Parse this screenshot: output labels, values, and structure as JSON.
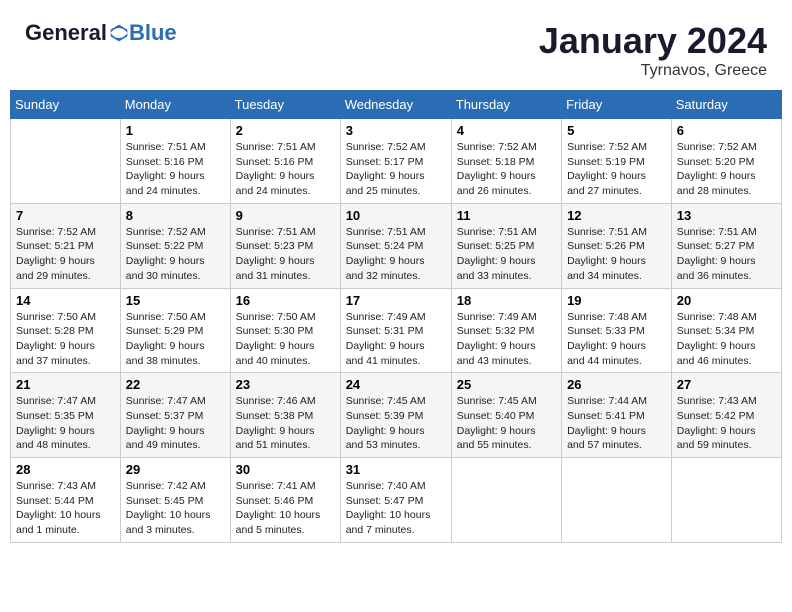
{
  "logo": {
    "general": "General",
    "blue": "Blue"
  },
  "header": {
    "month": "January 2024",
    "location": "Tyrnavos, Greece"
  },
  "days_of_week": [
    "Sunday",
    "Monday",
    "Tuesday",
    "Wednesday",
    "Thursday",
    "Friday",
    "Saturday"
  ],
  "weeks": [
    [
      {
        "day": "",
        "info": ""
      },
      {
        "day": "1",
        "info": "Sunrise: 7:51 AM\nSunset: 5:16 PM\nDaylight: 9 hours\nand 24 minutes."
      },
      {
        "day": "2",
        "info": "Sunrise: 7:51 AM\nSunset: 5:16 PM\nDaylight: 9 hours\nand 24 minutes."
      },
      {
        "day": "3",
        "info": "Sunrise: 7:52 AM\nSunset: 5:17 PM\nDaylight: 9 hours\nand 25 minutes."
      },
      {
        "day": "4",
        "info": "Sunrise: 7:52 AM\nSunset: 5:18 PM\nDaylight: 9 hours\nand 26 minutes."
      },
      {
        "day": "5",
        "info": "Sunrise: 7:52 AM\nSunset: 5:19 PM\nDaylight: 9 hours\nand 27 minutes."
      },
      {
        "day": "6",
        "info": "Sunrise: 7:52 AM\nSunset: 5:20 PM\nDaylight: 9 hours\nand 28 minutes."
      }
    ],
    [
      {
        "day": "7",
        "info": "Sunrise: 7:52 AM\nSunset: 5:21 PM\nDaylight: 9 hours\nand 29 minutes."
      },
      {
        "day": "8",
        "info": "Sunrise: 7:52 AM\nSunset: 5:22 PM\nDaylight: 9 hours\nand 30 minutes."
      },
      {
        "day": "9",
        "info": "Sunrise: 7:51 AM\nSunset: 5:23 PM\nDaylight: 9 hours\nand 31 minutes."
      },
      {
        "day": "10",
        "info": "Sunrise: 7:51 AM\nSunset: 5:24 PM\nDaylight: 9 hours\nand 32 minutes."
      },
      {
        "day": "11",
        "info": "Sunrise: 7:51 AM\nSunset: 5:25 PM\nDaylight: 9 hours\nand 33 minutes."
      },
      {
        "day": "12",
        "info": "Sunrise: 7:51 AM\nSunset: 5:26 PM\nDaylight: 9 hours\nand 34 minutes."
      },
      {
        "day": "13",
        "info": "Sunrise: 7:51 AM\nSunset: 5:27 PM\nDaylight: 9 hours\nand 36 minutes."
      }
    ],
    [
      {
        "day": "14",
        "info": "Sunrise: 7:50 AM\nSunset: 5:28 PM\nDaylight: 9 hours\nand 37 minutes."
      },
      {
        "day": "15",
        "info": "Sunrise: 7:50 AM\nSunset: 5:29 PM\nDaylight: 9 hours\nand 38 minutes."
      },
      {
        "day": "16",
        "info": "Sunrise: 7:50 AM\nSunset: 5:30 PM\nDaylight: 9 hours\nand 40 minutes."
      },
      {
        "day": "17",
        "info": "Sunrise: 7:49 AM\nSunset: 5:31 PM\nDaylight: 9 hours\nand 41 minutes."
      },
      {
        "day": "18",
        "info": "Sunrise: 7:49 AM\nSunset: 5:32 PM\nDaylight: 9 hours\nand 43 minutes."
      },
      {
        "day": "19",
        "info": "Sunrise: 7:48 AM\nSunset: 5:33 PM\nDaylight: 9 hours\nand 44 minutes."
      },
      {
        "day": "20",
        "info": "Sunrise: 7:48 AM\nSunset: 5:34 PM\nDaylight: 9 hours\nand 46 minutes."
      }
    ],
    [
      {
        "day": "21",
        "info": "Sunrise: 7:47 AM\nSunset: 5:35 PM\nDaylight: 9 hours\nand 48 minutes."
      },
      {
        "day": "22",
        "info": "Sunrise: 7:47 AM\nSunset: 5:37 PM\nDaylight: 9 hours\nand 49 minutes."
      },
      {
        "day": "23",
        "info": "Sunrise: 7:46 AM\nSunset: 5:38 PM\nDaylight: 9 hours\nand 51 minutes."
      },
      {
        "day": "24",
        "info": "Sunrise: 7:45 AM\nSunset: 5:39 PM\nDaylight: 9 hours\nand 53 minutes."
      },
      {
        "day": "25",
        "info": "Sunrise: 7:45 AM\nSunset: 5:40 PM\nDaylight: 9 hours\nand 55 minutes."
      },
      {
        "day": "26",
        "info": "Sunrise: 7:44 AM\nSunset: 5:41 PM\nDaylight: 9 hours\nand 57 minutes."
      },
      {
        "day": "27",
        "info": "Sunrise: 7:43 AM\nSunset: 5:42 PM\nDaylight: 9 hours\nand 59 minutes."
      }
    ],
    [
      {
        "day": "28",
        "info": "Sunrise: 7:43 AM\nSunset: 5:44 PM\nDaylight: 10 hours\nand 1 minute."
      },
      {
        "day": "29",
        "info": "Sunrise: 7:42 AM\nSunset: 5:45 PM\nDaylight: 10 hours\nand 3 minutes."
      },
      {
        "day": "30",
        "info": "Sunrise: 7:41 AM\nSunset: 5:46 PM\nDaylight: 10 hours\nand 5 minutes."
      },
      {
        "day": "31",
        "info": "Sunrise: 7:40 AM\nSunset: 5:47 PM\nDaylight: 10 hours\nand 7 minutes."
      },
      {
        "day": "",
        "info": ""
      },
      {
        "day": "",
        "info": ""
      },
      {
        "day": "",
        "info": ""
      }
    ]
  ]
}
